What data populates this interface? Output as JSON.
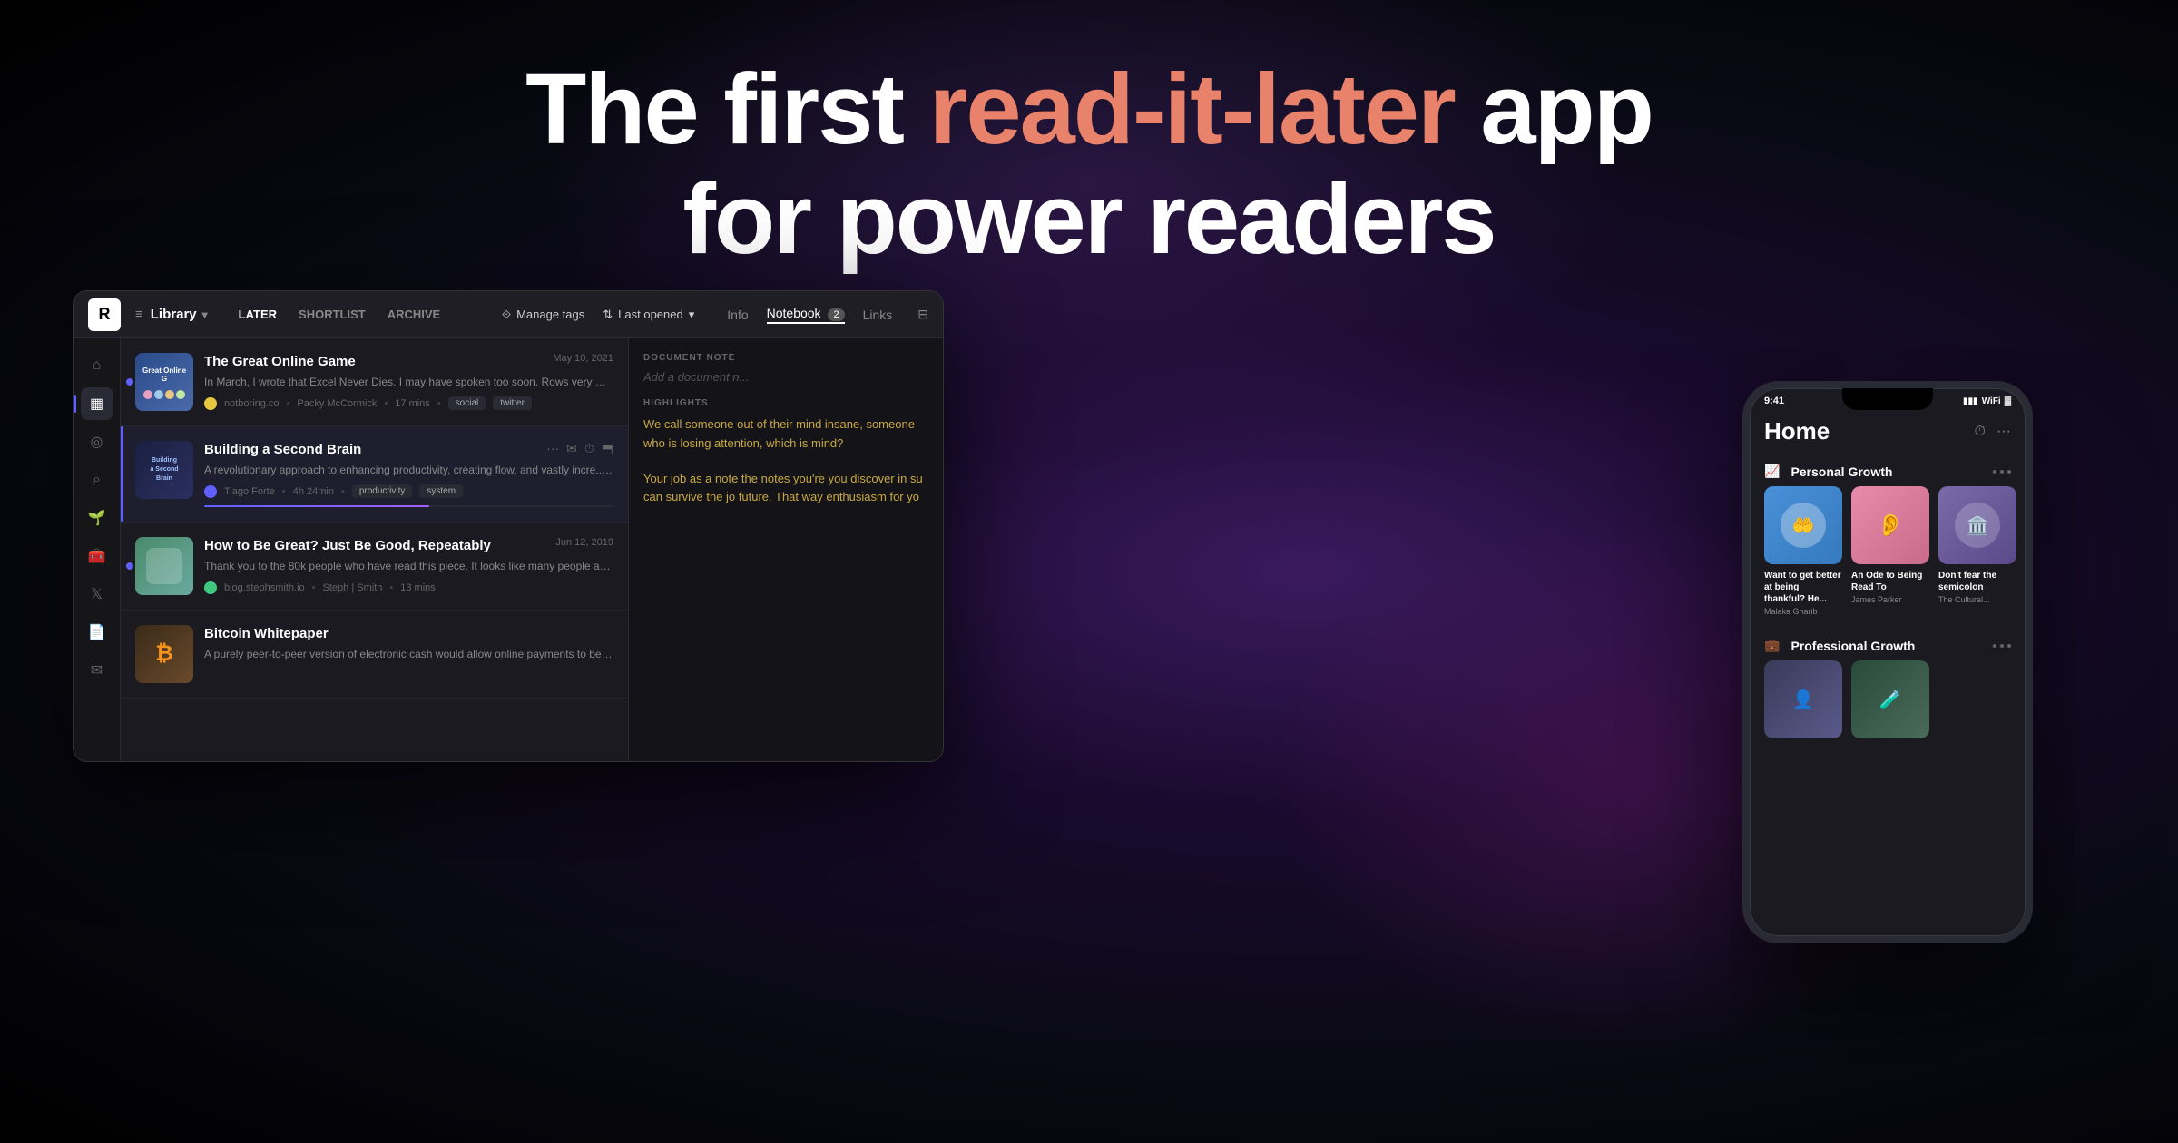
{
  "hero": {
    "line1_before": "The first ",
    "line1_highlight": "read-it-later",
    "line1_after": " app",
    "line2": "for power readers"
  },
  "app": {
    "logo": "R",
    "nav": {
      "library_label": "Library",
      "tabs": [
        "LATER",
        "SHORTLIST",
        "ARCHIVE"
      ]
    },
    "topbar_right": {
      "manage_tags": "Manage tags",
      "last_opened": "Last opened"
    },
    "right_panel_tabs": {
      "info": "Info",
      "notebook": "Notebook",
      "notebook_count": "2",
      "links": "Links"
    },
    "sidebar_icons": [
      {
        "name": "home",
        "symbol": "⌂"
      },
      {
        "name": "library",
        "symbol": "▦",
        "active": true
      },
      {
        "name": "feed",
        "symbol": "◎"
      },
      {
        "name": "search",
        "symbol": "⌕"
      },
      {
        "name": "plant",
        "symbol": "🌱"
      },
      {
        "name": "tools",
        "symbol": "🧰"
      },
      {
        "name": "twitter",
        "symbol": "𝕏"
      },
      {
        "name": "document",
        "symbol": "📄"
      },
      {
        "name": "mail",
        "symbol": "✉"
      }
    ],
    "articles": [
      {
        "id": "online-game",
        "title": "The Great Online Game",
        "excerpt": "In March, I wrote that Excel Never Dies. I may have spoken too soon. Rows very much...",
        "source": "notboring.co",
        "source_color": "#e8c840",
        "author": "Packy McCormick",
        "read_time": "17 mins",
        "date": "May 10, 2021",
        "tags": [
          "social",
          "twitter"
        ],
        "has_unread_dot": true
      },
      {
        "id": "second-brain",
        "title": "Building a Second Brain",
        "excerpt": "A revolutionary approach to enhancing productivity, creating flow, and vastly incre...g.",
        "source": "Tiago Forte",
        "source_color": "#6060ff",
        "author": "",
        "read_time": "4h 24min",
        "date": "",
        "tags": [
          "productivity",
          "system"
        ],
        "selected": true,
        "progress": 55
      },
      {
        "id": "be-great",
        "title": "How to Be Great? Just Be Good, Repeatably",
        "excerpt": "Thank you to the 80k people who have read this piece. It looks like many people are...",
        "source": "blog.stephsmith.io",
        "source_color": "#40c880",
        "author": "Steph | Smith",
        "read_time": "13 mins",
        "date": "Jun 12, 2019",
        "tags": [],
        "has_unread_dot": true
      },
      {
        "id": "bitcoin",
        "title": "Bitcoin Whitepaper",
        "excerpt": "A purely peer-to-peer version of electronic cash would allow online payments to be sent...",
        "source": "",
        "source_color": "#f7931a",
        "author": "",
        "read_time": "",
        "date": "",
        "tags": []
      }
    ],
    "right_panel": {
      "doc_note_label": "DOCUMENT NOTE",
      "doc_note_placeholder": "Add a document n...",
      "highlights_label": "HIGHLIGHTS",
      "highlight_text": "We call someone out of their mind insane, someone who is losing attention, which is mind?"
    }
  },
  "mobile": {
    "status_time": "9:41",
    "home_title": "Home",
    "sections": [
      {
        "name": "Personal Growth",
        "emoji": "📈",
        "cards": [
          {
            "title": "Want to get better at being thankful? He...",
            "author": "Malaka Gharib",
            "color": "blue"
          },
          {
            "title": "An Ode to Being Read To",
            "author": "James Parker",
            "color": "pink"
          },
          {
            "title": "Don't fear the semicolon",
            "author": "The Cultural...",
            "color": "purple"
          }
        ]
      },
      {
        "name": "Professional Growth",
        "emoji": "💼",
        "cards": []
      }
    ]
  }
}
